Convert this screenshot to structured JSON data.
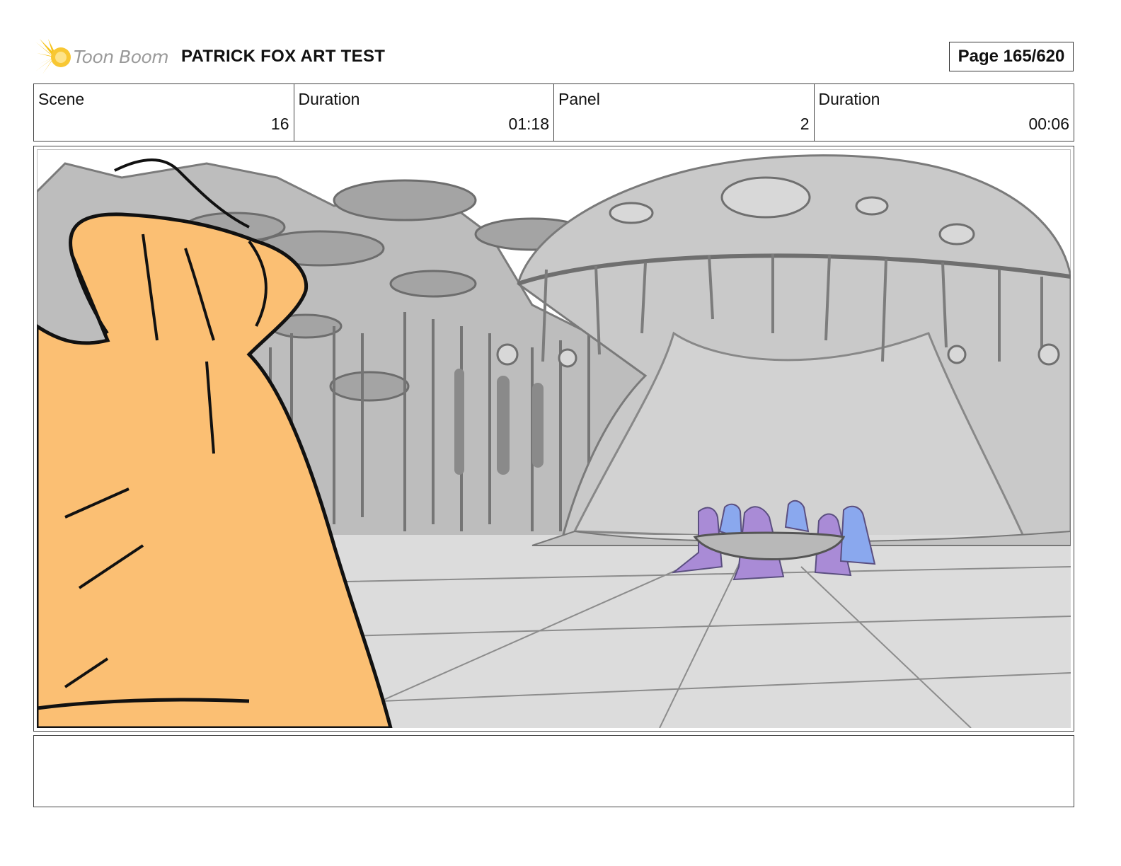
{
  "header": {
    "logo_text": "Toon Boom",
    "title": "PATRICK FOX ART TEST",
    "page_label": "Page 165/620"
  },
  "info": [
    {
      "label": "Scene",
      "value": "16"
    },
    {
      "label": "Duration",
      "value": "01:18"
    },
    {
      "label": "Panel",
      "value": "2"
    },
    {
      "label": "Duration",
      "value": "00:06"
    }
  ],
  "panel": {
    "image": "storyboard-drawing",
    "colors": {
      "foreground_character": "#fbbf73",
      "figures_purple": "#a98bd6",
      "figures_blue": "#8aa8ee",
      "background_gray": "#b3b3b3"
    }
  },
  "notes": {
    "text": ""
  }
}
